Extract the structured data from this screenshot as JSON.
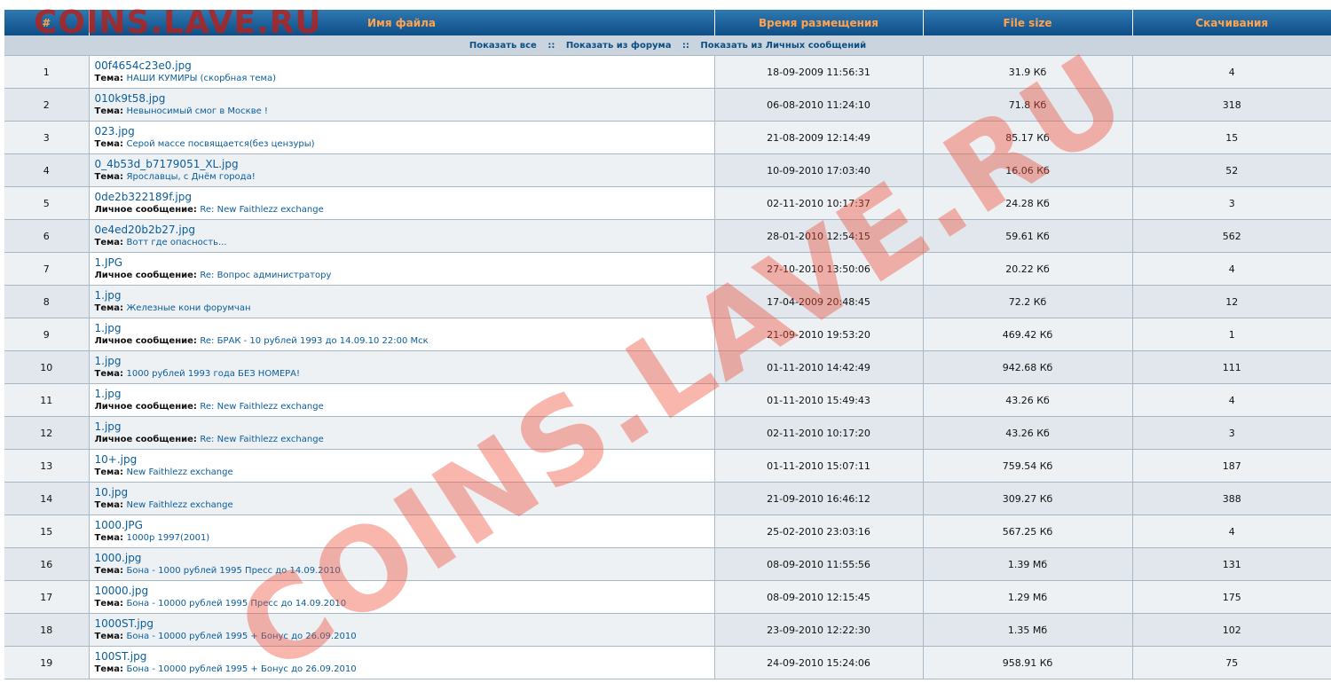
{
  "watermark": "COINS.LAVE.RU",
  "headers": {
    "num": "#",
    "name": "Имя файла",
    "date": "Время размещения",
    "size": "File size",
    "downloads": "Скачивания"
  },
  "filters": {
    "all": "Показать все",
    "forum": "Показать из форума",
    "pm": "Показать из Личных сообщений",
    "sep": "::"
  },
  "rows": [
    {
      "num": "1",
      "file": "00f4654c23e0.jpg",
      "label": "Тема:",
      "topic": "НАШИ КУМИРЫ (скорбная тема)",
      "date": "18-09-2009 11:56:31",
      "size": "31.9 Кб",
      "downloads": "4"
    },
    {
      "num": "2",
      "file": "010k9t58.jpg",
      "label": "Тема:",
      "topic": "Невыносимый смог в Москве !",
      "date": "06-08-2010 11:24:10",
      "size": "71.8 Кб",
      "downloads": "318"
    },
    {
      "num": "3",
      "file": "023.jpg",
      "label": "Тема:",
      "topic": "Серой массе посвящается(без цензуры)",
      "date": "21-08-2009 12:14:49",
      "size": "85.17 Кб",
      "downloads": "15"
    },
    {
      "num": "4",
      "file": "0_4b53d_b7179051_XL.jpg",
      "label": "Тема:",
      "topic": "Ярославцы, с Днём города!",
      "date": "10-09-2010 17:03:40",
      "size": "16.06 Кб",
      "downloads": "52"
    },
    {
      "num": "5",
      "file": "0de2b322189f.jpg",
      "label": "Личное сообщение:",
      "topic": "Re: New Faithlezz exchange",
      "date": "02-11-2010 10:17:37",
      "size": "24.28 Кб",
      "downloads": "3"
    },
    {
      "num": "6",
      "file": "0e4ed20b2b27.jpg",
      "label": "Тема:",
      "topic": "Вотт где опасность...",
      "date": "28-01-2010 12:54:15",
      "size": "59.61 Кб",
      "downloads": "562"
    },
    {
      "num": "7",
      "file": "1.JPG",
      "label": "Личное сообщение:",
      "topic": "Re: Вопрос администратору",
      "date": "27-10-2010 13:50:06",
      "size": "20.22 Кб",
      "downloads": "4"
    },
    {
      "num": "8",
      "file": "1.jpg",
      "label": "Тема:",
      "topic": "Железные кони форумчан",
      "date": "17-04-2009 20:48:45",
      "size": "72.2 Кб",
      "downloads": "12"
    },
    {
      "num": "9",
      "file": "1.jpg",
      "label": "Личное сообщение:",
      "topic": "Re: БРАК - 10 рублей 1993 до 14.09.10 22:00 Мск",
      "date": "21-09-2010 19:53:20",
      "size": "469.42 Кб",
      "downloads": "1"
    },
    {
      "num": "10",
      "file": "1.jpg",
      "label": "Тема:",
      "topic": "1000 рублей 1993 года БЕЗ НОМЕРА!",
      "date": "01-11-2010 14:42:49",
      "size": "942.68 Кб",
      "downloads": "111"
    },
    {
      "num": "11",
      "file": "1.jpg",
      "label": "Личное сообщение:",
      "topic": "Re: New Faithlezz exchange",
      "date": "01-11-2010 15:49:43",
      "size": "43.26 Кб",
      "downloads": "4"
    },
    {
      "num": "12",
      "file": "1.jpg",
      "label": "Личное сообщение:",
      "topic": "Re: New Faithlezz exchange",
      "date": "02-11-2010 10:17:20",
      "size": "43.26 Кб",
      "downloads": "3"
    },
    {
      "num": "13",
      "file": "10+.jpg",
      "label": "Тема:",
      "topic": "New Faithlezz exchange",
      "date": "01-11-2010 15:07:11",
      "size": "759.54 Кб",
      "downloads": "187"
    },
    {
      "num": "14",
      "file": "10.jpg",
      "label": "Тема:",
      "topic": "New Faithlezz exchange",
      "date": "21-09-2010 16:46:12",
      "size": "309.27 Кб",
      "downloads": "388"
    },
    {
      "num": "15",
      "file": "1000.JPG",
      "label": "Тема:",
      "topic": "1000р 1997(2001)",
      "date": "25-02-2010 23:03:16",
      "size": "567.25 Кб",
      "downloads": "4"
    },
    {
      "num": "16",
      "file": "1000.jpg",
      "label": "Тема:",
      "topic": "Бона - 1000 рублей 1995 Пресс до 14.09.2010",
      "date": "08-09-2010 11:55:56",
      "size": "1.39 Мб",
      "downloads": "131"
    },
    {
      "num": "17",
      "file": "10000.jpg",
      "label": "Тема:",
      "topic": "Бона - 10000 рублей 1995 Пресс до 14.09.2010",
      "date": "08-09-2010 12:15:45",
      "size": "1.29 Мб",
      "downloads": "175"
    },
    {
      "num": "18",
      "file": "1000ST.jpg",
      "label": "Тема:",
      "topic": "Бона - 10000 рублей 1995 + Бонус до 26.09.2010",
      "date": "23-09-2010 12:22:30",
      "size": "1.35 Мб",
      "downloads": "102"
    },
    {
      "num": "19",
      "file": "100ST.jpg",
      "label": "Тема:",
      "topic": "Бона - 10000 рублей 1995 + Бонус до 26.09.2010",
      "date": "24-09-2010 15:24:06",
      "size": "958.91 Кб",
      "downloads": "75"
    }
  ]
}
